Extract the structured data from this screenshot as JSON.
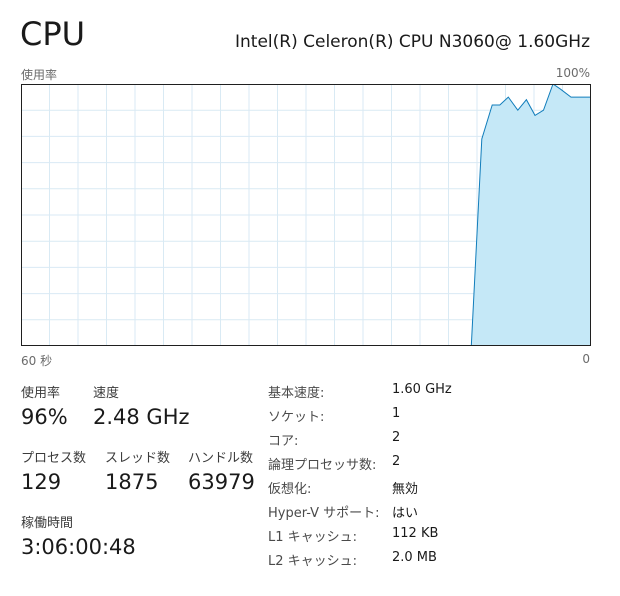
{
  "header": {
    "title": "CPU",
    "model": "Intel(R) Celeron(R) CPU N3060@ 1.60GHz"
  },
  "graph": {
    "usage_label": "使用率",
    "max_label": "100%",
    "time_left_label": "60 秒",
    "time_right_label": "0",
    "line_color": "#117dbb",
    "fill_color": "#c5e8f7",
    "grid_color": "#d9eaf4",
    "x_range_seconds": [
      60,
      0
    ],
    "y_range_percent": [
      0,
      100
    ]
  },
  "chart_data": {
    "type": "area",
    "title": "",
    "xlabel": "",
    "ylabel": "",
    "x_unit": "seconds ago",
    "xlim": [
      60,
      0
    ],
    "ylim": [
      0,
      100
    ],
    "x": [
      60,
      12.6,
      11.5,
      10.4,
      9.6,
      8.7,
      7.7,
      6.8,
      5.9,
      5.0,
      4.0,
      3.2,
      2.1,
      1.3,
      0
    ],
    "y": [
      0,
      0,
      79,
      92,
      92,
      95,
      90,
      94,
      88,
      90,
      100,
      98,
      95,
      95,
      95
    ],
    "grid": true
  },
  "stats": {
    "usage": {
      "label": "使用率",
      "value": "96%"
    },
    "speed": {
      "label": "速度",
      "value": "2.48 GHz"
    },
    "processes": {
      "label": "プロセス数",
      "value": "129"
    },
    "threads": {
      "label": "スレッド数",
      "value": "1875"
    },
    "handles": {
      "label": "ハンドル数",
      "value": "63979"
    },
    "uptime": {
      "label": "稼働時間",
      "value": "3:06:00:48"
    }
  },
  "specs": [
    {
      "label": "基本速度:",
      "value": "1.60 GHz"
    },
    {
      "label": "ソケット:",
      "value": "1"
    },
    {
      "label": "コア:",
      "value": "2"
    },
    {
      "label": "論理プロセッサ数:",
      "value": "2"
    },
    {
      "label": "仮想化:",
      "value": "無効"
    },
    {
      "label": "Hyper-V サポート:",
      "value": "はい"
    },
    {
      "label": "L1 キャッシュ:",
      "value": "112 KB"
    },
    {
      "label": "L2 キャッシュ:",
      "value": "2.0 MB"
    }
  ]
}
